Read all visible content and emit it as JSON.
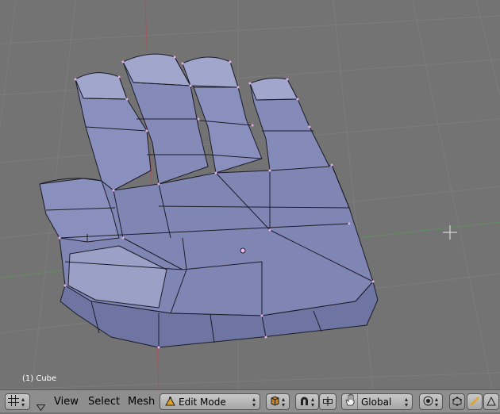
{
  "viewport": {
    "object_label": "(1) Cube"
  },
  "header": {
    "menus": [
      "View",
      "Select",
      "Mesh"
    ],
    "mode_label": "Edit Mode",
    "orientation_label": "Global",
    "icons": {
      "editor_type": "grid-icon",
      "collapse": "triangle-down-icon",
      "shading": "cube-shading-icon",
      "snap": "magnet-icon",
      "pivot": "pivot-icon",
      "manipulator": "hand-icon",
      "proportional": "proportional-edit-icon",
      "vertex_select": "vertex-select-icon",
      "edge_select": "edge-select-icon",
      "face_select": "face-select-icon"
    }
  }
}
